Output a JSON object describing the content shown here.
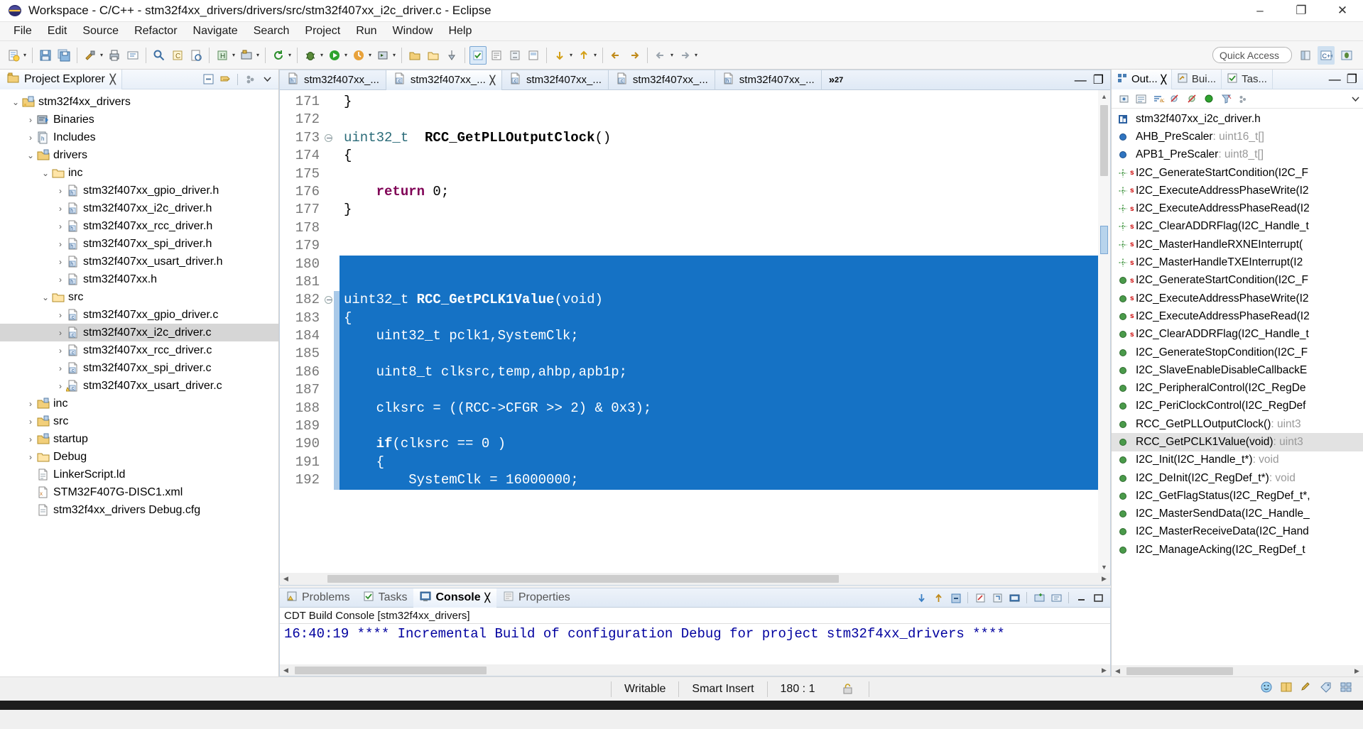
{
  "window": {
    "title": "Workspace - C/C++ - stm32f4xx_drivers/drivers/src/stm32f407xx_i2c_driver.c - Eclipse",
    "app_icon": "eclipse-icon",
    "minimize": "–",
    "maximize": "❐",
    "close": "✕"
  },
  "menu": [
    "File",
    "Edit",
    "Source",
    "Refactor",
    "Navigate",
    "Search",
    "Project",
    "Run",
    "Window",
    "Help"
  ],
  "toolbar": {
    "quick_access_placeholder": "Quick Access",
    "buttons": [
      "new-wizard-icon",
      "save-icon",
      "save-all-icon",
      "build-icon",
      "print-icon",
      "rename-icon",
      "search-icon",
      "open-type-icon",
      "open-resource-icon",
      "new-class-icon",
      "build-config-icon",
      "refresh-icon",
      "debug-icon",
      "run-icon",
      "profile-icon",
      "run-external-icon",
      "coverage-icon",
      "new-folder-icon",
      "open-folder-icon",
      "pin-icon",
      "toggle-mark-icon",
      "editor-presentation-icon",
      "show-whitespace-icon",
      "block-selection-icon",
      "next-annotation-icon",
      "prev-annotation-icon",
      "back-icon",
      "forward-icon",
      "prev-edit-icon",
      "next-edit-icon"
    ]
  },
  "project_explorer": {
    "tab_label": "Project Explorer",
    "close_glyph": "╳",
    "toolbar_icons": [
      "collapse-all-icon",
      "link-with-editor-icon",
      "view-menu-icon",
      "chevron-down-icon"
    ],
    "tree": [
      {
        "indent": 0,
        "twist": "⌄",
        "icon": "project-icon",
        "label": "stm32f4xx_drivers",
        "selected": false
      },
      {
        "indent": 1,
        "twist": "›",
        "icon": "binaries-icon",
        "label": "Binaries",
        "selected": false
      },
      {
        "indent": 1,
        "twist": "›",
        "icon": "includes-icon",
        "label": "Includes",
        "selected": false
      },
      {
        "indent": 1,
        "twist": "⌄",
        "icon": "srcfolder-icon",
        "label": "drivers",
        "selected": false
      },
      {
        "indent": 2,
        "twist": "⌄",
        "icon": "folder-icon",
        "label": "inc",
        "selected": false
      },
      {
        "indent": 3,
        "twist": "›",
        "icon": "hfile-icon",
        "label": "stm32f407xx_gpio_driver.h",
        "selected": false
      },
      {
        "indent": 3,
        "twist": "›",
        "icon": "hfile-icon",
        "label": "stm32f407xx_i2c_driver.h",
        "selected": false
      },
      {
        "indent": 3,
        "twist": "›",
        "icon": "hfile-icon",
        "label": "stm32f407xx_rcc_driver.h",
        "selected": false
      },
      {
        "indent": 3,
        "twist": "›",
        "icon": "hfile-icon",
        "label": "stm32f407xx_spi_driver.h",
        "selected": false
      },
      {
        "indent": 3,
        "twist": "›",
        "icon": "hfile-icon",
        "label": "stm32f407xx_usart_driver.h",
        "selected": false
      },
      {
        "indent": 3,
        "twist": "›",
        "icon": "hfile-icon",
        "label": "stm32f407xx.h",
        "selected": false
      },
      {
        "indent": 2,
        "twist": "⌄",
        "icon": "folder-icon",
        "label": "src",
        "selected": false
      },
      {
        "indent": 3,
        "twist": "›",
        "icon": "cfile-icon",
        "label": "stm32f407xx_gpio_driver.c",
        "selected": false
      },
      {
        "indent": 3,
        "twist": "›",
        "icon": "cfile-icon",
        "label": "stm32f407xx_i2c_driver.c",
        "selected": true
      },
      {
        "indent": 3,
        "twist": "›",
        "icon": "cfile-icon",
        "label": "stm32f407xx_rcc_driver.c",
        "selected": false
      },
      {
        "indent": 3,
        "twist": "›",
        "icon": "cfile-icon",
        "label": "stm32f407xx_spi_driver.c",
        "selected": false
      },
      {
        "indent": 3,
        "twist": "›",
        "icon": "cfile-warn-icon",
        "label": "stm32f407xx_usart_driver.c",
        "selected": false
      },
      {
        "indent": 1,
        "twist": "›",
        "icon": "srcfolder-icon",
        "label": "inc",
        "selected": false
      },
      {
        "indent": 1,
        "twist": "›",
        "icon": "srcfolder-icon",
        "label": "src",
        "selected": false
      },
      {
        "indent": 1,
        "twist": "›",
        "icon": "srcfolder-icon",
        "label": "startup",
        "selected": false
      },
      {
        "indent": 1,
        "twist": "›",
        "icon": "folder-icon",
        "label": "Debug",
        "selected": false
      },
      {
        "indent": 1,
        "twist": "",
        "icon": "ld-icon",
        "label": "LinkerScript.ld",
        "selected": false
      },
      {
        "indent": 1,
        "twist": "",
        "icon": "xml-icon",
        "label": "STM32F407G-DISC1.xml",
        "selected": false
      },
      {
        "indent": 1,
        "twist": "",
        "icon": "cfg-icon",
        "label": "stm32f4xx_drivers Debug.cfg",
        "selected": false
      }
    ]
  },
  "editor": {
    "tabs": [
      {
        "label": "stm32f407xx_...",
        "icon": "hfile-icon",
        "active": false,
        "dirty": false,
        "closable": false
      },
      {
        "label": "stm32f407xx_...",
        "icon": "cfile-icon",
        "active": true,
        "dirty": false,
        "closable": true
      },
      {
        "label": "stm32f407xx_...",
        "icon": "cfile-icon",
        "active": false,
        "dirty": false,
        "closable": false
      },
      {
        "label": "stm32f407xx_...",
        "icon": "cfile-icon",
        "active": false,
        "dirty": false,
        "closable": false
      },
      {
        "label": "stm32f407xx_...",
        "icon": "hfile-icon",
        "active": false,
        "dirty": false,
        "closable": false
      }
    ],
    "more_tabs_glyph": "»",
    "more_tabs_count": "27",
    "minimize_glyph": "—",
    "maximize_glyph": "❐",
    "first_line_number": 171,
    "lines": [
      {
        "n": 171,
        "text": "}",
        "fold": false,
        "sel": false,
        "changed": false
      },
      {
        "n": 172,
        "text": "",
        "fold": false,
        "sel": false,
        "changed": false
      },
      {
        "n": 173,
        "text": "uint32_t  RCC_GetPLLOutputClock()",
        "fold": true,
        "sel": false,
        "changed": false
      },
      {
        "n": 174,
        "text": "{",
        "fold": false,
        "sel": false,
        "changed": false
      },
      {
        "n": 175,
        "text": "",
        "fold": false,
        "sel": false,
        "changed": false
      },
      {
        "n": 176,
        "text": "    return 0;",
        "fold": false,
        "sel": false,
        "changed": false
      },
      {
        "n": 177,
        "text": "}",
        "fold": false,
        "sel": false,
        "changed": false
      },
      {
        "n": 178,
        "text": "",
        "fold": false,
        "sel": false,
        "changed": false
      },
      {
        "n": 179,
        "text": "",
        "fold": false,
        "sel": false,
        "changed": false
      },
      {
        "n": 180,
        "text": "",
        "fold": false,
        "sel": true,
        "changed": false
      },
      {
        "n": 181,
        "text": "",
        "fold": false,
        "sel": true,
        "changed": false
      },
      {
        "n": 182,
        "text": "uint32_t RCC_GetPCLK1Value(void)",
        "fold": true,
        "sel": true,
        "changed": true
      },
      {
        "n": 183,
        "text": "{",
        "fold": false,
        "sel": true,
        "changed": true
      },
      {
        "n": 184,
        "text": "    uint32_t pclk1,SystemClk;",
        "fold": false,
        "sel": true,
        "changed": true
      },
      {
        "n": 185,
        "text": "",
        "fold": false,
        "sel": true,
        "changed": true
      },
      {
        "n": 186,
        "text": "    uint8_t clksrc,temp,ahbp,apb1p;",
        "fold": false,
        "sel": true,
        "changed": true
      },
      {
        "n": 187,
        "text": "",
        "fold": false,
        "sel": true,
        "changed": true
      },
      {
        "n": 188,
        "text": "    clksrc = ((RCC->CFGR >> 2) & 0x3);",
        "fold": false,
        "sel": true,
        "changed": true
      },
      {
        "n": 189,
        "text": "",
        "fold": false,
        "sel": true,
        "changed": true
      },
      {
        "n": 190,
        "text": "    if(clksrc == 0 )",
        "fold": false,
        "sel": true,
        "changed": true
      },
      {
        "n": 191,
        "text": "    {",
        "fold": false,
        "sel": true,
        "changed": true
      },
      {
        "n": 192,
        "text": "        SystemClk = 16000000;",
        "fold": false,
        "sel": true,
        "changed": true
      }
    ]
  },
  "console": {
    "tabs": [
      {
        "label": "Problems",
        "icon": "problems-icon",
        "active": false,
        "closable": false
      },
      {
        "label": "Tasks",
        "icon": "tasks-icon",
        "active": false,
        "closable": false
      },
      {
        "label": "Console",
        "icon": "console-icon",
        "active": true,
        "closable": true
      },
      {
        "label": "Properties",
        "icon": "properties-icon",
        "active": false,
        "closable": false
      }
    ],
    "close_glyph": "╳",
    "subtitle": "CDT Build Console [stm32f4xx_drivers]",
    "body": "16:40:19 **** Incremental Build of configuration Debug for project stm32f4xx_drivers ****",
    "toolbar_icons": [
      "scroll-down-icon",
      "scroll-up-icon",
      "scroll-lock-icon",
      "clear-console-icon",
      "pin-console-icon",
      "display-selected-console-icon",
      "new-console-view-icon",
      "open-console-icon",
      "minimize-icon",
      "maximize-icon"
    ]
  },
  "outline": {
    "tabs": [
      {
        "label": "Out...",
        "icon": "outline-icon",
        "active": true,
        "closable": true
      },
      {
        "label": "Bui...",
        "icon": "build-icon",
        "active": false,
        "closable": false
      },
      {
        "label": "Tas...",
        "icon": "tasks-icon",
        "active": false,
        "closable": false
      }
    ],
    "close_glyph": "╳",
    "minimize_glyph": "—",
    "maximize_glyph": "❐",
    "toolbar_icons": [
      "focus-active-task-icon",
      "hide-fields-icon",
      "sort-icon",
      "hide-static-icon",
      "hide-nonpublic-icon",
      "hide-inactive-icon",
      "filter-icon",
      "view-menu-icon",
      "chevron-down-icon"
    ],
    "items": [
      {
        "icon": "header-icon",
        "kind": "",
        "name": "stm32f407xx_i2c_driver.h",
        "type": "",
        "selected": false
      },
      {
        "icon": "var-blue-icon",
        "kind": "",
        "name": "AHB_PreScaler",
        "type": " : uint16_t[]",
        "selected": false
      },
      {
        "icon": "var-blue-icon",
        "kind": "",
        "name": "APB1_PreScaler",
        "type": " : uint8_t[]",
        "selected": false
      },
      {
        "icon": "proto-icon",
        "kind": "s",
        "name": "I2C_GenerateStartCondition(I2C_F",
        "type": "",
        "selected": false
      },
      {
        "icon": "proto-icon",
        "kind": "s",
        "name": "I2C_ExecuteAddressPhaseWrite(I2",
        "type": "",
        "selected": false
      },
      {
        "icon": "proto-icon",
        "kind": "s",
        "name": "I2C_ExecuteAddressPhaseRead(I2",
        "type": "",
        "selected": false
      },
      {
        "icon": "proto-icon",
        "kind": "s",
        "name": "I2C_ClearADDRFlag(I2C_Handle_t",
        "type": "",
        "selected": false
      },
      {
        "icon": "proto-icon",
        "kind": "s",
        "name": "I2C_MasterHandleRXNEInterrupt(",
        "type": "",
        "selected": false
      },
      {
        "icon": "proto-icon",
        "kind": "s",
        "name": "I2C_MasterHandleTXEInterrupt(I2",
        "type": "",
        "selected": false
      },
      {
        "icon": "func-icon",
        "kind": "s",
        "name": "I2C_GenerateStartCondition(I2C_F",
        "type": "",
        "selected": false
      },
      {
        "icon": "func-icon",
        "kind": "s",
        "name": "I2C_ExecuteAddressPhaseWrite(I2",
        "type": "",
        "selected": false
      },
      {
        "icon": "func-icon",
        "kind": "s",
        "name": "I2C_ExecuteAddressPhaseRead(I2",
        "type": "",
        "selected": false
      },
      {
        "icon": "func-icon",
        "kind": "s",
        "name": "I2C_ClearADDRFlag(I2C_Handle_t",
        "type": "",
        "selected": false
      },
      {
        "icon": "func-icon",
        "kind": "",
        "name": "I2C_GenerateStopCondition(I2C_F",
        "type": "",
        "selected": false
      },
      {
        "icon": "func-icon",
        "kind": "",
        "name": "I2C_SlaveEnableDisableCallbackE",
        "type": "",
        "selected": false
      },
      {
        "icon": "func-icon",
        "kind": "",
        "name": "I2C_PeripheralControl(I2C_RegDe",
        "type": "",
        "selected": false
      },
      {
        "icon": "func-icon",
        "kind": "",
        "name": "I2C_PeriClockControl(I2C_RegDef",
        "type": "",
        "selected": false
      },
      {
        "icon": "func-icon",
        "kind": "",
        "name": "RCC_GetPLLOutputClock()",
        "type": " : uint3",
        "selected": false
      },
      {
        "icon": "func-icon",
        "kind": "",
        "name": "RCC_GetPCLK1Value(void)",
        "type": " : uint3",
        "selected": true
      },
      {
        "icon": "func-icon",
        "kind": "",
        "name": "I2C_Init(I2C_Handle_t*)",
        "type": " : void",
        "selected": false
      },
      {
        "icon": "func-icon",
        "kind": "",
        "name": "I2C_DeInit(I2C_RegDef_t*)",
        "type": " : void",
        "selected": false
      },
      {
        "icon": "func-icon",
        "kind": "",
        "name": "I2C_GetFlagStatus(I2C_RegDef_t*,",
        "type": "",
        "selected": false
      },
      {
        "icon": "func-icon",
        "kind": "",
        "name": "I2C_MasterSendData(I2C_Handle_",
        "type": "",
        "selected": false
      },
      {
        "icon": "func-icon",
        "kind": "",
        "name": "I2C_MasterReceiveData(I2C_Hand",
        "type": "",
        "selected": false
      },
      {
        "icon": "func-icon",
        "kind": "",
        "name": "I2C_ManageAcking(I2C_RegDef_t",
        "type": "",
        "selected": false
      }
    ]
  },
  "statusbar": {
    "writable": "Writable",
    "insert_mode": "Smart Insert",
    "position": "180 : 1",
    "lock_icon": "writable-lock-icon",
    "right_icons": [
      "smiley-icon",
      "book-icon",
      "pencil-icon",
      "tag-icon",
      "grid-icon"
    ]
  },
  "colors": {
    "selection_blue": "#1572c5",
    "console_text": "#00009f",
    "keyword": "#7f0055",
    "type": "#2a6b78",
    "tree_selected": "#d6d6d6"
  }
}
